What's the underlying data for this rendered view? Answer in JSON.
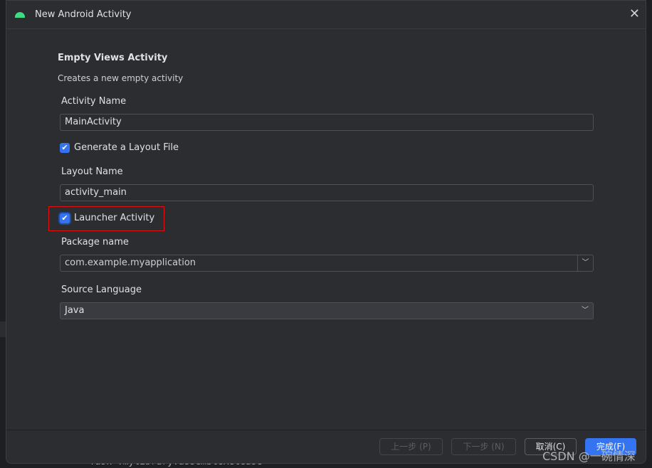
{
  "background": {
    "console_text": "> Task :mylibrary:assembleRelease"
  },
  "dialog": {
    "title": "New Android Activity",
    "heading": "Empty Views Activity",
    "description": "Creates a new empty activity",
    "activity_name": {
      "label": "Activity Name",
      "value": "MainActivity"
    },
    "generate_layout": {
      "label": "Generate a Layout File",
      "checked": true
    },
    "layout_name": {
      "label": "Layout Name",
      "value": "activity_main"
    },
    "launcher_activity": {
      "label": "Launcher Activity",
      "checked": true
    },
    "package_name": {
      "label": "Package name",
      "value": "com.example.myapplication"
    },
    "source_language": {
      "label": "Source Language",
      "value": "Java"
    },
    "buttons": {
      "previous": "上一步 (P)",
      "next": "下一步 (N)",
      "cancel": "取消(C)",
      "finish": "完成(F)"
    }
  },
  "watermark": "CSDN @一碗情深",
  "colors": {
    "accent": "#3574f0",
    "android_icon": "#3ddc84",
    "highlight_box": "#e01010"
  }
}
